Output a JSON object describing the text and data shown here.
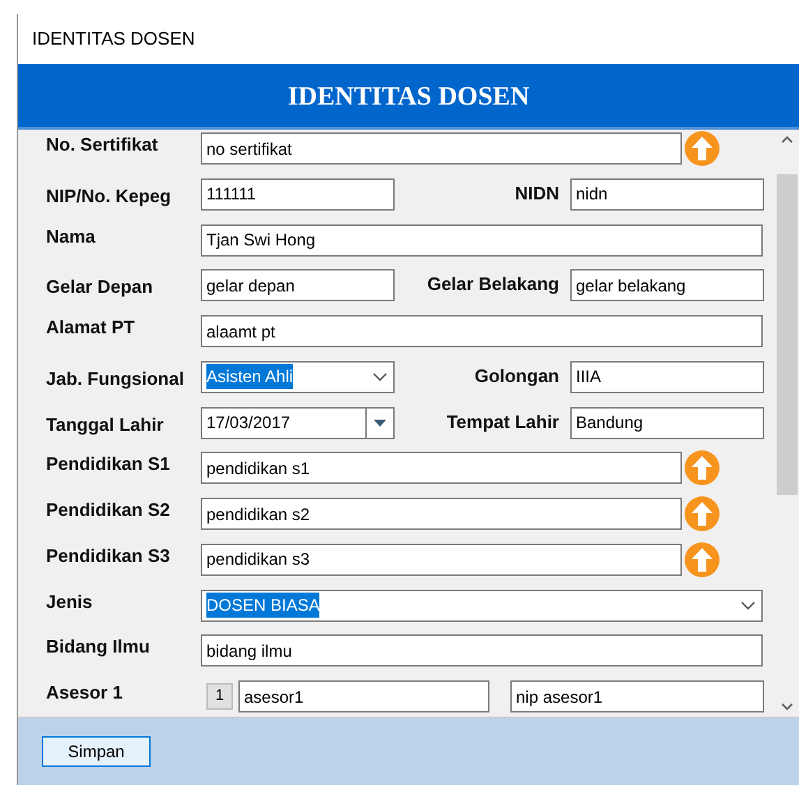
{
  "window": {
    "title": "IDENTITAS DOSEN"
  },
  "header": {
    "title": "IDENTITAS DOSEN"
  },
  "rows": [
    {
      "kind": "single",
      "label": "No. Sertifikat",
      "field": {
        "kind": "text",
        "value": "no sertifikat"
      },
      "upload": true
    },
    {
      "kind": "pair",
      "label": "NIP/No. Kepeg",
      "field": {
        "kind": "text",
        "value": "111111"
      },
      "label2": "NIDN",
      "field2": {
        "kind": "text",
        "value": "nidn"
      }
    },
    {
      "kind": "single",
      "label": "Nama",
      "field": {
        "kind": "text",
        "value": "Tjan Swi Hong"
      },
      "upload": false
    },
    {
      "kind": "pair",
      "label": "Gelar Depan",
      "field": {
        "kind": "text",
        "value": "gelar depan"
      },
      "label2": "Gelar Belakang",
      "field2": {
        "kind": "text",
        "value": "gelar belakang"
      }
    },
    {
      "kind": "single",
      "label": "Alamat PT",
      "field": {
        "kind": "text",
        "value": "alaamt pt"
      },
      "upload": false
    },
    {
      "kind": "pair",
      "label": "Jab. Fungsional",
      "field": {
        "kind": "select",
        "value": "Asisten Ahli",
        "highlighted": true
      },
      "label2": "Golongan",
      "field2": {
        "kind": "text",
        "value": "IIIA"
      }
    },
    {
      "kind": "pair",
      "label": "Tanggal Lahir",
      "field": {
        "kind": "date",
        "value": "17/03/2017"
      },
      "label2": "Tempat Lahir",
      "field2": {
        "kind": "text",
        "value": "Bandung"
      }
    },
    {
      "kind": "single",
      "label": "Pendidikan S1",
      "field": {
        "kind": "text",
        "value": "pendidikan s1"
      },
      "upload": true
    },
    {
      "kind": "single",
      "label": "Pendidikan S2",
      "field": {
        "kind": "text",
        "value": "pendidikan s2"
      },
      "upload": true
    },
    {
      "kind": "single",
      "label": "Pendidikan S3",
      "field": {
        "kind": "text",
        "value": "pendidikan s3"
      },
      "upload": true
    },
    {
      "kind": "single",
      "label": "Jenis",
      "field": {
        "kind": "select",
        "value": "DOSEN BIASA",
        "highlighted": true
      },
      "upload": false
    },
    {
      "kind": "single",
      "label": "Bidang Ilmu",
      "field": {
        "kind": "text",
        "value": "bidang ilmu"
      },
      "upload": false
    },
    {
      "kind": "asesor",
      "label": "Asesor 1",
      "badge": "1",
      "field": {
        "kind": "text",
        "value": "asesor1"
      },
      "field2": {
        "kind": "text",
        "value": "nip asesor1"
      }
    }
  ],
  "footer": {
    "button": "Simpan"
  }
}
